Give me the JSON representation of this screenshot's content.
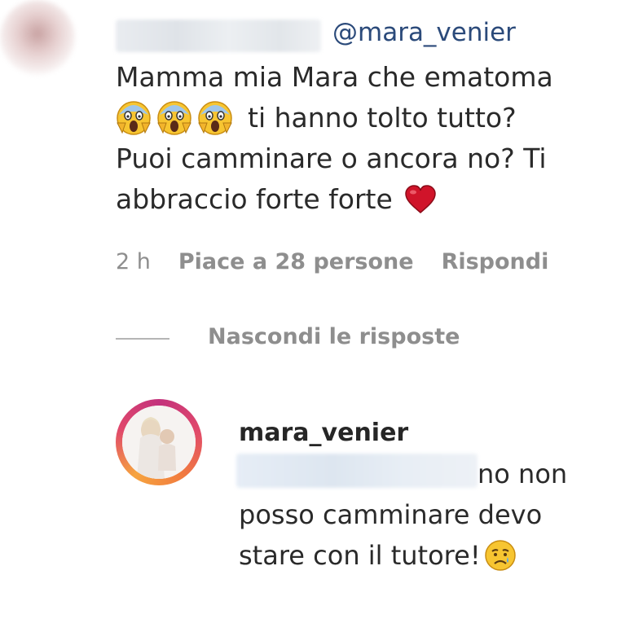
{
  "comment": {
    "mention": "@mara_venier",
    "line1": "Mamma mia Mara che ematoma",
    "line2_text": "ti hanno tolto tutto?",
    "line3": "Puoi camminare o ancora no? Ti",
    "line4": "abbraccio forte forte",
    "emojis": [
      "scream-face-icon",
      "scream-face-icon",
      "scream-face-icon",
      "red-heart-icon"
    ]
  },
  "meta": {
    "time": "2 h",
    "likes": "Piace a 28 persone",
    "reply": "Rispondi"
  },
  "replies_toggle": {
    "label": "Nascondi le risposte"
  },
  "reply": {
    "username": "mara_venier",
    "line1": "no non",
    "line2": "posso camminare devo",
    "line3": "stare con il tutore!",
    "emoji": "disappointed-face-icon"
  },
  "colors": {
    "mention": "#2b4a7a",
    "meta_text": "#8e8e8e",
    "heart": "#d0142a",
    "story_ring": "#e0486b"
  }
}
